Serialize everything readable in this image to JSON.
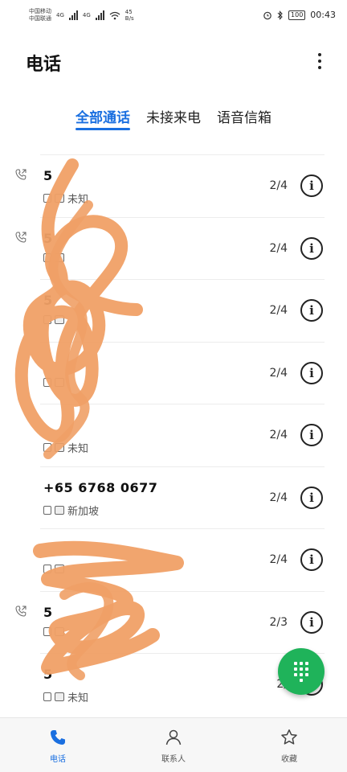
{
  "status_bar": {
    "carrier_1": "中国移动",
    "carrier_2": "中国联通",
    "network_1": "4G",
    "network_2": "4G",
    "speed": "45 B/s",
    "battery": "100",
    "time": "00:43"
  },
  "header": {
    "title": "电话"
  },
  "tabs": [
    {
      "label": "全部通话",
      "active": true
    },
    {
      "label": "未接来电",
      "active": false
    },
    {
      "label": "语音信箱",
      "active": false
    }
  ],
  "calls": [
    {
      "number": "5",
      "location": "未知",
      "date": "2/4",
      "outgoing": true
    },
    {
      "number": "5",
      "location": "",
      "date": "2/4",
      "outgoing": true
    },
    {
      "number": "5",
      "location": "",
      "date": "2/4",
      "outgoing": false
    },
    {
      "number": "",
      "location": "",
      "date": "2/4",
      "outgoing": false
    },
    {
      "number": "",
      "location": "未知",
      "date": "2/4",
      "outgoing": false
    },
    {
      "number": "+65 6768 0677",
      "location": "新加坡",
      "date": "2/4",
      "outgoing": false
    },
    {
      "number": "",
      "location": "",
      "date": "2/4",
      "outgoing": false
    },
    {
      "number": "5",
      "location": "",
      "date": "2/3",
      "outgoing": true
    },
    {
      "number": "5",
      "location": "未知",
      "date": "2/",
      "outgoing": false
    }
  ],
  "bottom_nav": [
    {
      "label": "电话",
      "icon": "phone-icon",
      "active": true
    },
    {
      "label": "联系人",
      "icon": "person-icon",
      "active": false
    },
    {
      "label": "收藏",
      "icon": "star-icon",
      "active": false
    }
  ],
  "colors": {
    "accent": "#1a6fe0",
    "fab": "#1fb35a",
    "redaction": "#f0a066"
  }
}
